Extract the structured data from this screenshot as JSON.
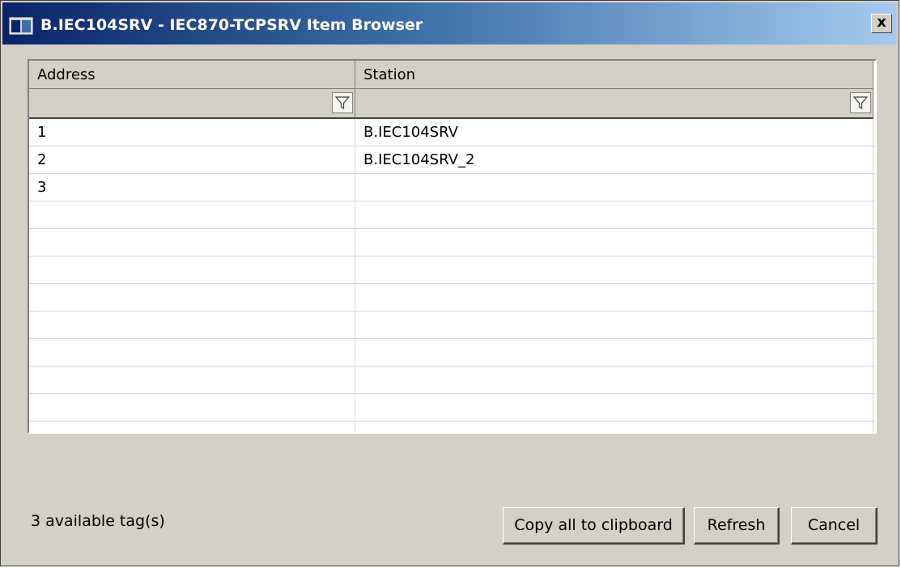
{
  "window": {
    "title": "B.IEC104SRV - IEC870-TCPSRV Item Browser",
    "close_glyph": "x"
  },
  "grid": {
    "columns": [
      "Address",
      "Station"
    ],
    "rows": [
      [
        "1",
        "B.IEC104SRV"
      ],
      [
        "2",
        "B.IEC104SRV_2"
      ],
      [
        "3",
        ""
      ],
      [
        "",
        ""
      ],
      [
        "",
        ""
      ],
      [
        "",
        ""
      ],
      [
        "",
        ""
      ],
      [
        "",
        ""
      ],
      [
        "",
        ""
      ],
      [
        "",
        ""
      ],
      [
        "",
        ""
      ],
      [
        "",
        ""
      ]
    ]
  },
  "footer": {
    "status": "3 available tag(s)",
    "copy_label": "Copy all to clipboard",
    "refresh_label": "Refresh",
    "cancel_label": "Cancel"
  },
  "icons": {
    "app": "app-icon",
    "filter": "filter-icon",
    "close": "close-icon"
  }
}
